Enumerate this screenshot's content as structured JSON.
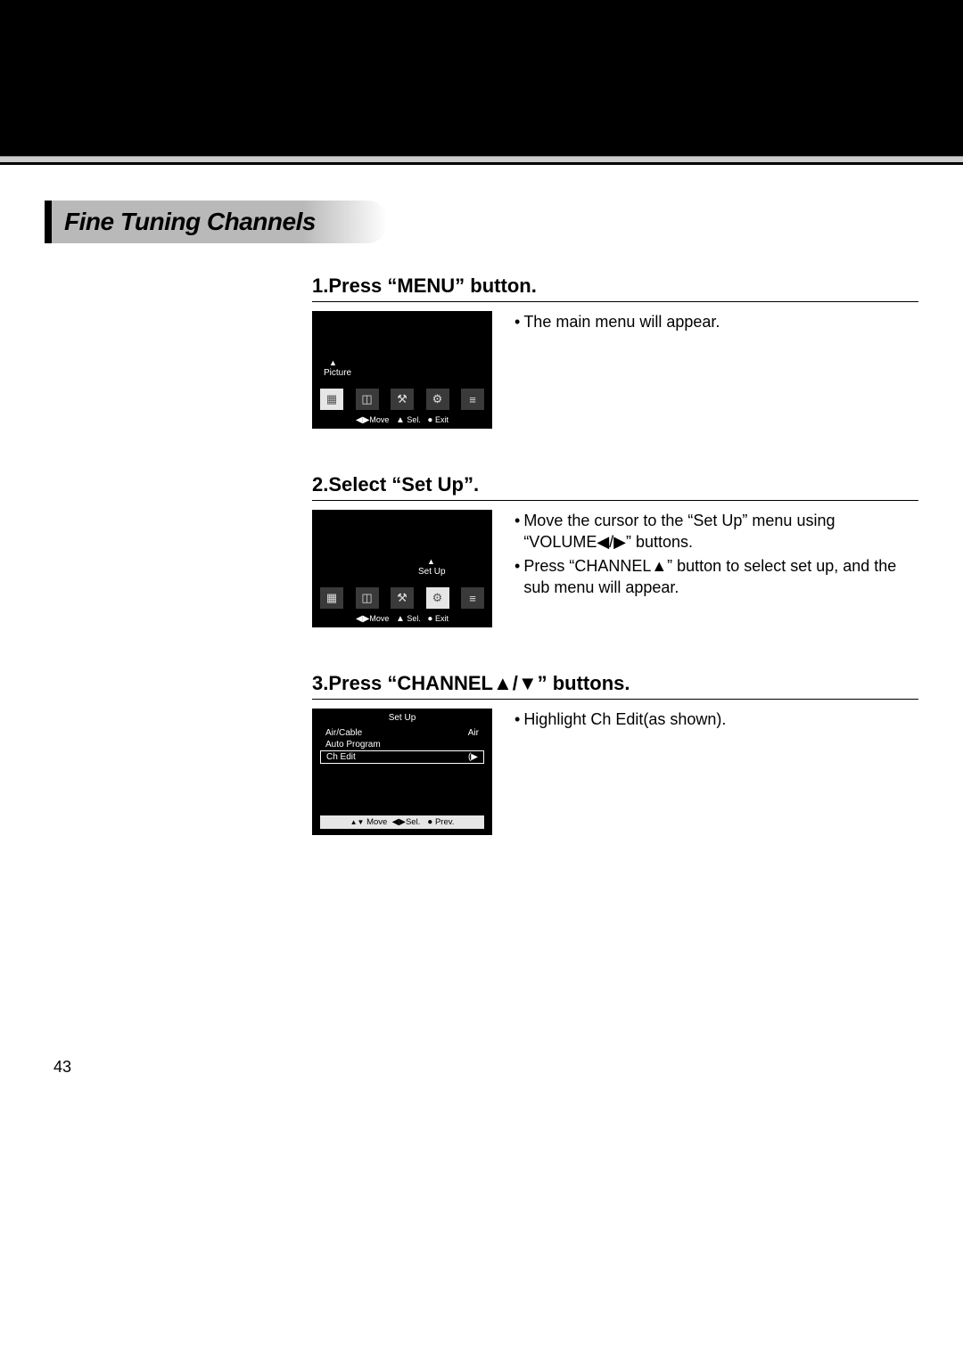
{
  "page": {
    "number": "43",
    "section_title": "Fine Tuning Channels"
  },
  "steps": [
    {
      "title": "1.Press “MENU” button.",
      "screen": {
        "label": "Picture",
        "highlight_index": 0,
        "hints": {
          "move": "Move",
          "sel": "Sel.",
          "exit": "Exit"
        }
      },
      "desc": [
        "The main menu will appear."
      ]
    },
    {
      "title": "2.Select “Set Up”.",
      "screen": {
        "label": "Set Up",
        "highlight_index": 3,
        "hints": {
          "move": "Move",
          "sel": "Sel.",
          "exit": "Exit"
        }
      },
      "desc": [
        "Move the cursor to the  “Set Up” menu using “VOLUME◀/▶” buttons.",
        "Press “CHANNEL▲” button to select set up, and the sub menu will appear."
      ]
    },
    {
      "title": "3.Press “CHANNEL▲/▼” buttons.",
      "screen3": {
        "title": "Set Up",
        "rows": [
          {
            "label": "Air/Cable",
            "value": "Air",
            "boxed": false
          },
          {
            "label": "Auto Program",
            "value": "",
            "boxed": false
          },
          {
            "label": "Ch Edit",
            "value": "(▶",
            "boxed": true
          }
        ],
        "hints": {
          "move": "Move",
          "sel": "Sel.",
          "prev": "Prev."
        }
      },
      "desc": [
        "Highlight Ch Edit(as shown)."
      ]
    }
  ],
  "glyphs": {
    "tri_up": "▲",
    "tri_down": "▼",
    "tri_lr": "◀▶",
    "dot": "●",
    "updown": "▲▼"
  },
  "icons": [
    "▦",
    "◫",
    "⚒",
    "⚙",
    "≡"
  ]
}
